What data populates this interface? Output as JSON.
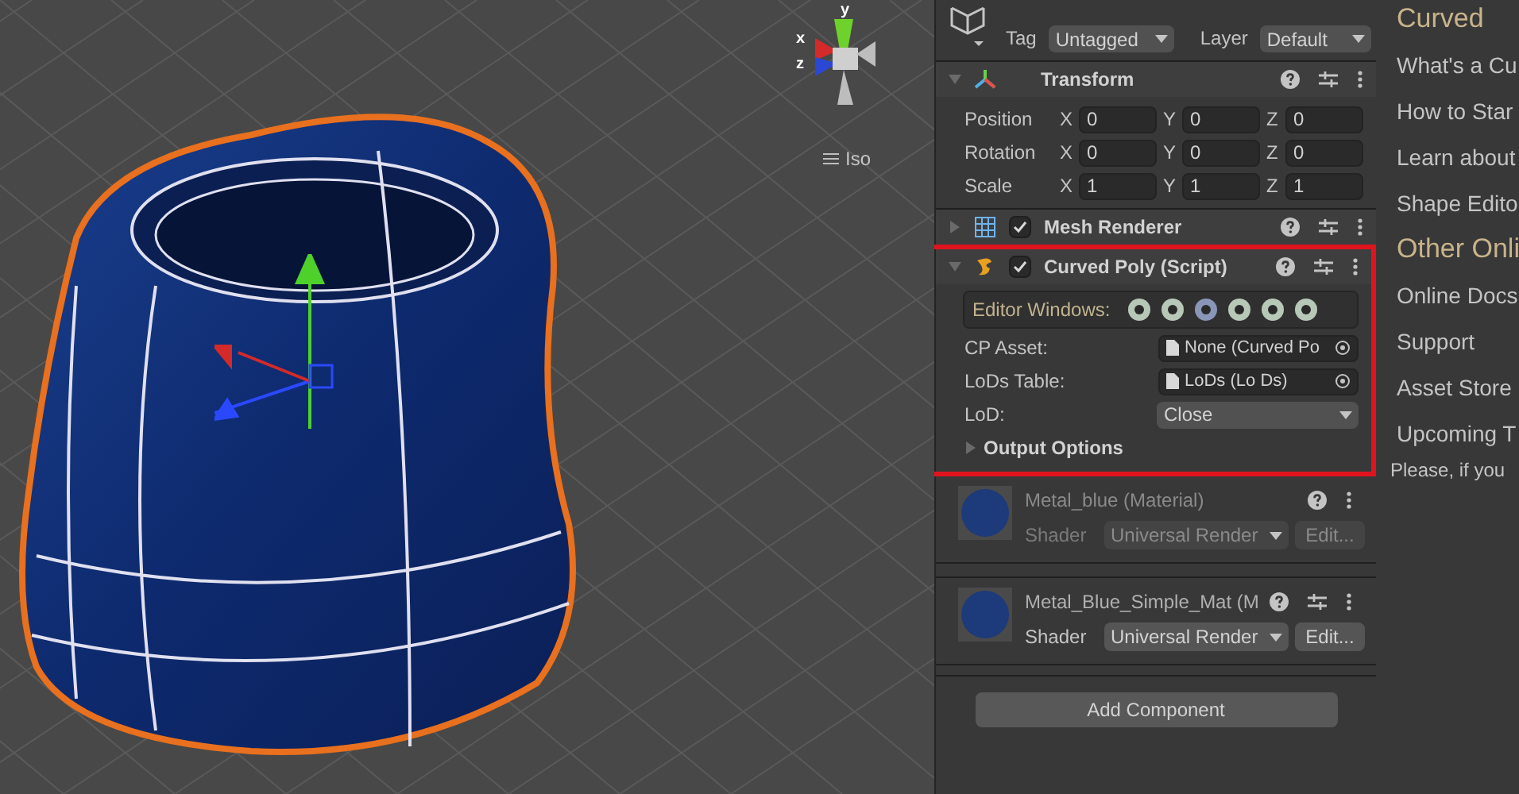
{
  "scene": {
    "gizmo_axes": [
      {
        "label": "y",
        "color": "#6fd12c"
      },
      {
        "label": "x",
        "color": "#d42a2a"
      },
      {
        "label": "z",
        "color": "#2a48d4"
      }
    ],
    "view_mode": "Iso"
  },
  "inspector": {
    "header": {
      "tag_label": "Tag",
      "tag": "Untagged",
      "layer_label": "Layer",
      "layer": "Default"
    },
    "components": [
      {
        "kind": "transform",
        "title": "Transform",
        "expanded": true,
        "rows": [
          {
            "label": "Position",
            "fields": [
              {
                "axis": "X",
                "value": "0"
              },
              {
                "axis": "Y",
                "value": "0"
              },
              {
                "axis": "Z",
                "value": "0"
              }
            ]
          },
          {
            "label": "Rotation",
            "fields": [
              {
                "axis": "X",
                "value": "0"
              },
              {
                "axis": "Y",
                "value": "0"
              },
              {
                "axis": "Z",
                "value": "0"
              }
            ]
          },
          {
            "label": "Scale",
            "fields": [
              {
                "axis": "X",
                "value": "1"
              },
              {
                "axis": "Y",
                "value": "1"
              },
              {
                "axis": "Z",
                "value": "1"
              }
            ]
          }
        ]
      },
      {
        "kind": "mesh_renderer",
        "title": "Mesh Renderer",
        "expanded": false,
        "enabled": true
      },
      {
        "kind": "script",
        "title": "Curved Poly (Script)",
        "expanded": true,
        "enabled": true,
        "highlighted": true,
        "editor_windows_label": "Editor Windows:",
        "fields": [
          {
            "kind": "object",
            "label": "CP Asset:",
            "value": "None (Curved Po"
          },
          {
            "kind": "object",
            "label": "LoDs Table:",
            "value": "LoDs (Lo Ds)"
          },
          {
            "kind": "dropdown",
            "label": "LoD:",
            "value": "Close"
          }
        ],
        "foldout": {
          "label": "Output Options",
          "expanded": false
        }
      }
    ],
    "materials": [
      {
        "name": "Metal_blue (Material)",
        "shader_label": "Shader",
        "shader": "Universal Render",
        "edit": "Edit...",
        "disabled": true
      },
      {
        "name": "Metal_Blue_Simple_Mat (M",
        "shader_label": "Shader",
        "shader": "Universal Render",
        "edit": "Edit...",
        "disabled": false
      }
    ],
    "add_component": "Add Component"
  },
  "help_panel": {
    "items": [
      {
        "kind": "heading",
        "text": "Curved"
      },
      {
        "kind": "link",
        "text": "What's a Cu"
      },
      {
        "kind": "link",
        "text": "How to Star"
      },
      {
        "kind": "link",
        "text": "Learn about"
      },
      {
        "kind": "link",
        "text": "Shape Edito"
      },
      {
        "kind": "heading",
        "text": "Other Onli"
      },
      {
        "kind": "link",
        "text": "Online Docs"
      },
      {
        "kind": "link",
        "text": "Support"
      },
      {
        "kind": "link",
        "text": "Asset Store"
      },
      {
        "kind": "link",
        "text": "Upcoming T"
      },
      {
        "kind": "note",
        "text": "Please, if you"
      }
    ]
  }
}
